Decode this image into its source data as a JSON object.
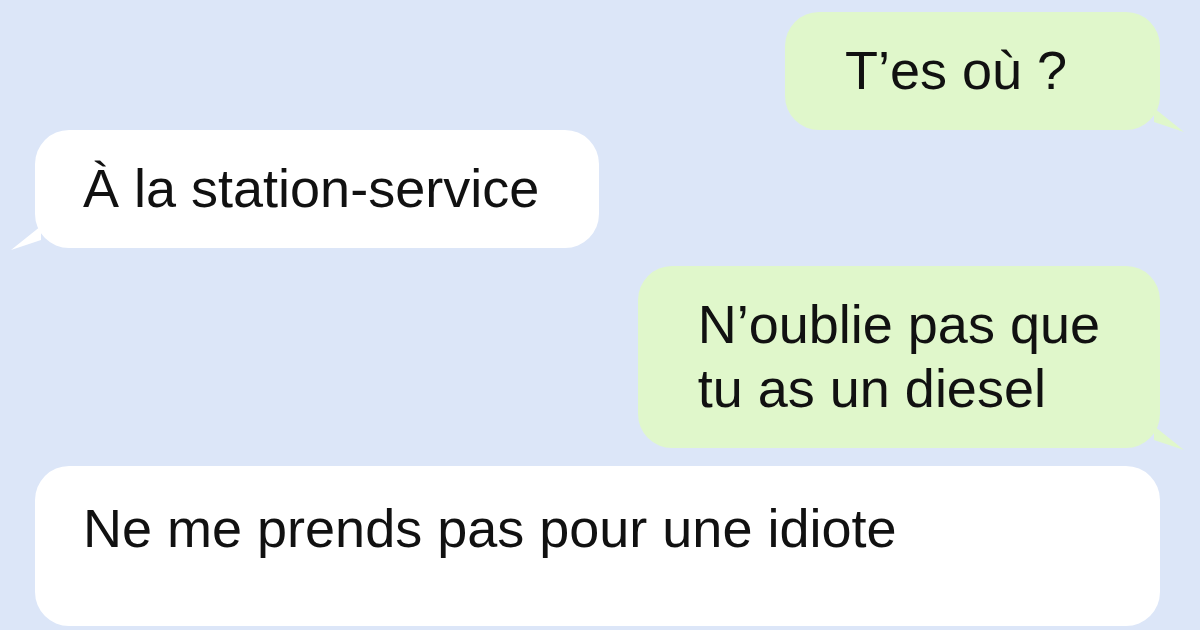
{
  "messages": [
    {
      "kind": "outgoing",
      "text": "T’es où ?"
    },
    {
      "kind": "incoming",
      "text": "À la station-service"
    },
    {
      "kind": "outgoing",
      "text": "N’oublie pas que\ntu as un diesel"
    },
    {
      "kind": "incoming",
      "text": "Ne me prends pas pour une idiote"
    }
  ]
}
